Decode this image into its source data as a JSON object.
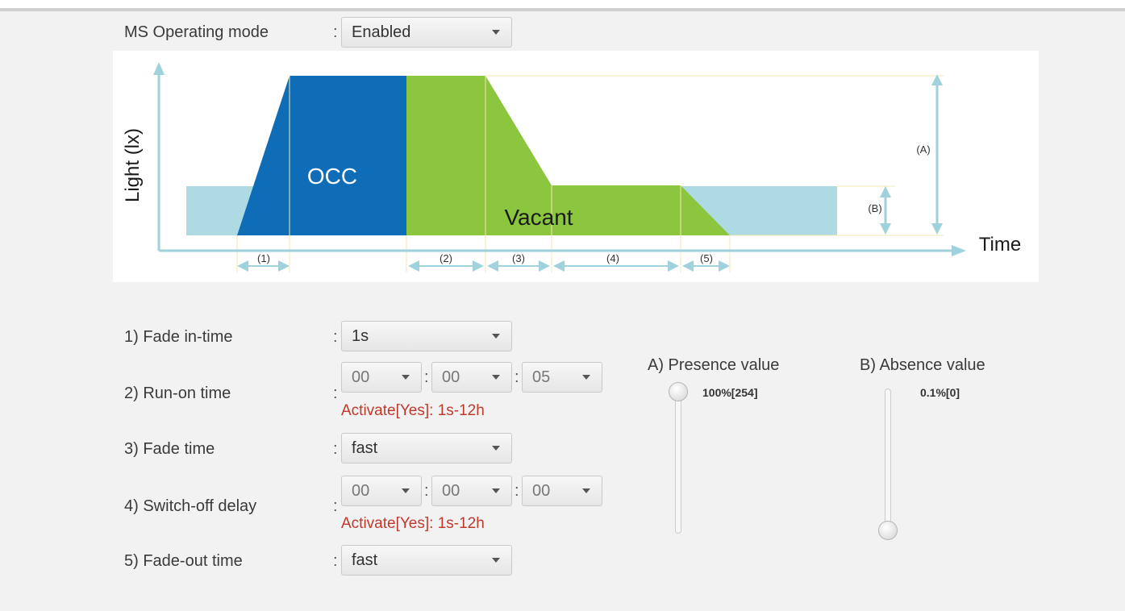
{
  "header": {
    "operating_mode_label": "MS Operating mode",
    "operating_mode_value": "Enabled"
  },
  "diagram": {
    "y_axis_label": "Light (lx)",
    "x_axis_label": "Time",
    "occ_label": "OCC",
    "vacant_label": "Vacant",
    "marker_a": "(A)",
    "marker_b": "(B)",
    "interval_labels": [
      "(1)",
      "(2)",
      "(3)",
      "(4)",
      "(5)"
    ],
    "colors": {
      "occ": "#0f6cb6",
      "vacant": "#8cc63f",
      "base": "#aedbe3",
      "arrow": "#9fd2dc"
    }
  },
  "settings": {
    "fade_in": {
      "label": "1) Fade in-time",
      "value": "1s"
    },
    "run_on": {
      "label": "2) Run-on time",
      "h": "00",
      "m": "00",
      "s": "05",
      "note": "Activate[Yes]: 1s-12h"
    },
    "fade_time": {
      "label": "3) Fade time",
      "value": "fast"
    },
    "switch_off": {
      "label": "4) Switch-off delay",
      "h": "00",
      "m": "00",
      "s": "00",
      "note": "Activate[Yes]: 1s-12h"
    },
    "fade_out": {
      "label": "5) Fade-out time",
      "value": "fast"
    }
  },
  "sliders": {
    "presence": {
      "title": "A) Presence value",
      "value_text": "100%[254]",
      "level": 1.0
    },
    "absence": {
      "title": "B) Absence value",
      "value_text": "0.1%[0]",
      "level": 0.0
    }
  },
  "colon": ":"
}
